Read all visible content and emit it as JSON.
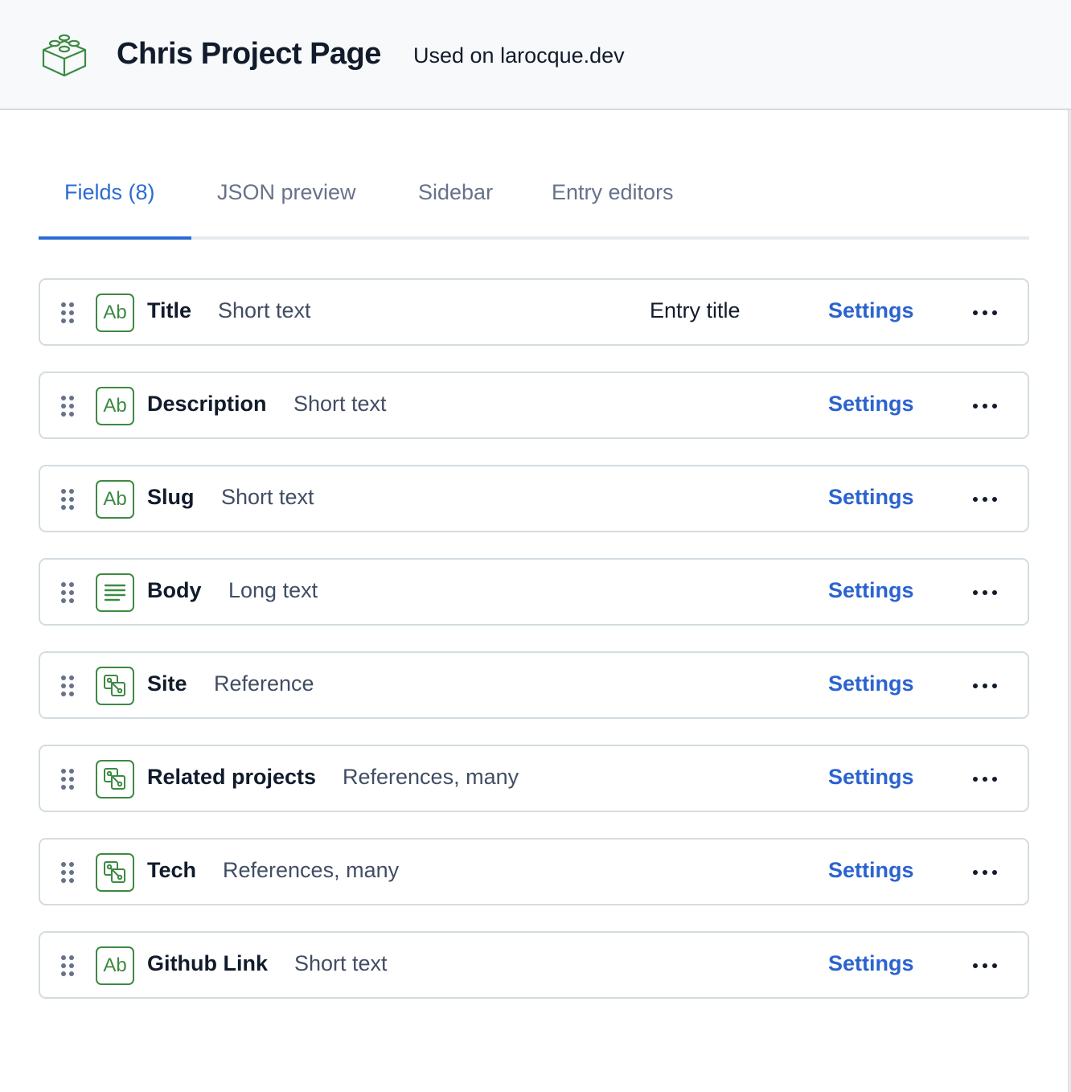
{
  "header": {
    "logo_icon": "content-type-block-icon",
    "title": "Chris Project Page",
    "used_on": "Used on larocque.dev"
  },
  "colors": {
    "accent": "#2b6cd4",
    "link": "#2b63d0",
    "icon_green": "#3c8a43",
    "text_primary": "#111b2b",
    "text_secondary": "#414d63",
    "tab_inactive": "#67728a"
  },
  "tabs": [
    {
      "label": "Fields (8)",
      "active": true
    },
    {
      "label": "JSON preview",
      "active": false
    },
    {
      "label": "Sidebar",
      "active": false
    },
    {
      "label": "Entry editors",
      "active": false
    }
  ],
  "fields": [
    {
      "name": "Title",
      "type": "Short text",
      "icon": "short-text-icon",
      "badge": "Entry title",
      "settings_label": "Settings",
      "more_icon": "more-horizontal-icon"
    },
    {
      "name": "Description",
      "type": "Short text",
      "icon": "short-text-icon",
      "badge": "",
      "settings_label": "Settings",
      "more_icon": "more-horizontal-icon"
    },
    {
      "name": "Slug",
      "type": "Short text",
      "icon": "short-text-icon",
      "badge": "",
      "settings_label": "Settings",
      "more_icon": "more-horizontal-icon"
    },
    {
      "name": "Body",
      "type": "Long text",
      "icon": "long-text-icon",
      "badge": "",
      "settings_label": "Settings",
      "more_icon": "more-horizontal-icon"
    },
    {
      "name": "Site",
      "type": "Reference",
      "icon": "reference-icon",
      "badge": "",
      "settings_label": "Settings",
      "more_icon": "more-horizontal-icon"
    },
    {
      "name": "Related projects",
      "type": "References, many",
      "icon": "reference-icon",
      "badge": "",
      "settings_label": "Settings",
      "more_icon": "more-horizontal-icon"
    },
    {
      "name": "Tech",
      "type": "References, many",
      "icon": "reference-icon",
      "badge": "",
      "settings_label": "Settings",
      "more_icon": "more-horizontal-icon"
    },
    {
      "name": "Github Link",
      "type": "Short text",
      "icon": "short-text-icon",
      "badge": "",
      "settings_label": "Settings",
      "more_icon": "more-horizontal-icon"
    }
  ],
  "short_text_glyph": "Ab"
}
